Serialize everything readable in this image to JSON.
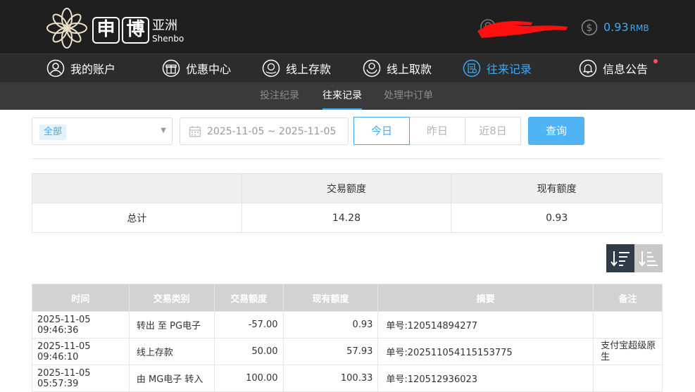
{
  "header": {
    "logo_char1": "申",
    "logo_char2": "博",
    "logo_cn": "亚洲",
    "logo_en": "Shenbo",
    "balance_value": "0.93",
    "balance_unit": "RMB"
  },
  "nav": {
    "items": [
      {
        "label": "我的账户",
        "icon": "user-circle-icon"
      },
      {
        "label": "优惠中心",
        "icon": "gift-icon"
      },
      {
        "label": "线上存款",
        "icon": "deposit-icon"
      },
      {
        "label": "线上取款",
        "icon": "withdraw-icon"
      },
      {
        "label": "往来记录",
        "icon": "records-icon",
        "active": true
      },
      {
        "label": "信息公告",
        "icon": "bell-icon"
      }
    ]
  },
  "subnav": {
    "items": [
      "投注纪录",
      "往来记录",
      "处理中订单"
    ],
    "active": "往来记录"
  },
  "filters": {
    "type_selected": "全部",
    "date_range": "2025-11-05 ~ 2025-11-05",
    "quick": [
      "今日",
      "昨日",
      "近8日"
    ],
    "quick_active": "今日",
    "query_label": "查询"
  },
  "summary": {
    "headers": [
      "",
      "交易额度",
      "现有额度"
    ],
    "row": [
      "总计",
      "14.28",
      "0.93"
    ]
  },
  "records": {
    "headers": [
      "时间",
      "交易类别",
      "交易额度",
      "现有额度",
      "摘要",
      "备注"
    ],
    "rows": [
      [
        "2025-11-05 09:46:36",
        "转出 至 PG电子",
        "-57.00",
        "0.93",
        "单号:120514894277",
        ""
      ],
      [
        "2025-11-05 09:46:10",
        "线上存款",
        "50.00",
        "57.93",
        "单号:202511054115153775",
        "支付宝超级原生"
      ],
      [
        "2025-11-05 05:57:39",
        "由 MG电子 转入",
        "100.00",
        "100.33",
        "单号:120512936023",
        ""
      ]
    ]
  },
  "colors": {
    "accent": "#3fa9f5",
    "header_bg": "#1f1f1f",
    "nav_bg": "#2c2c2c",
    "subnav_bg": "#3a3a3a"
  }
}
